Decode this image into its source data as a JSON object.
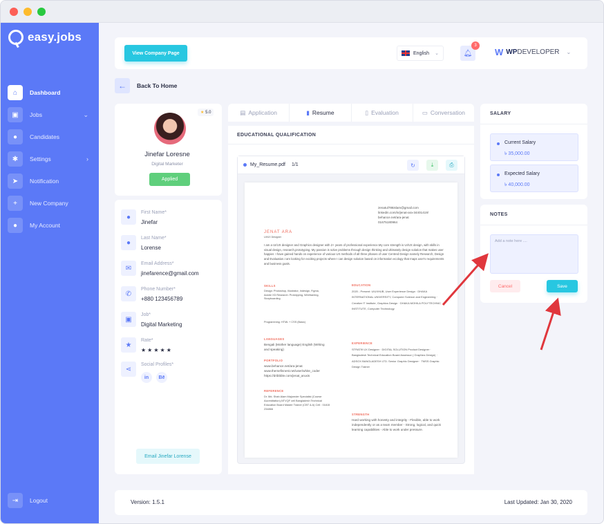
{
  "app": {
    "name": "easy.jobs"
  },
  "colors": {
    "primary": "#5b79f7",
    "accent": "#27c7e1",
    "success": "#5fcf7c",
    "danger": "#ff6b6b",
    "star": "#fdbb2d"
  },
  "sidebar": {
    "items": [
      {
        "label": "Dashboard",
        "icon": "home-icon"
      },
      {
        "label": "Jobs",
        "icon": "briefcase-icon"
      },
      {
        "label": "Candidates",
        "icon": "user-icon"
      },
      {
        "label": "Settings",
        "icon": "gear-icon"
      },
      {
        "label": "Notification",
        "icon": "pointer-icon"
      },
      {
        "label": "New Company",
        "icon": "plus-icon"
      },
      {
        "label": "My Account",
        "icon": "user-icon"
      }
    ],
    "logout": "Logout"
  },
  "topbar": {
    "view_company": "View Company Page",
    "language": "English",
    "notifications": "3",
    "brand_wp": "WP",
    "brand_rest": "DEVELOPER"
  },
  "back": {
    "label": "Back To Home"
  },
  "candidate": {
    "rating": "5.0",
    "name": "Jinefar Loresne",
    "title": "Digital Marketer",
    "status": "Applied",
    "fields": {
      "first_name": {
        "label": "First Name*",
        "value": "Jinefar"
      },
      "last_name": {
        "label": "Last Name*",
        "value": "Lorense"
      },
      "email": {
        "label": "Email Address*",
        "value": "jinefarence@gmail.com"
      },
      "phone": {
        "label": "Phone Number*",
        "value": "+880 123456789"
      },
      "job": {
        "label": "Job*",
        "value": "Digital Marketing"
      },
      "rate": {
        "label": "Rate*",
        "value": "★★★★★"
      },
      "social": {
        "label": "Social Profiles*",
        "linkedin": "in",
        "behance": "Bē"
      }
    },
    "email_button": "Email Jinefar Lorense"
  },
  "tabs": [
    {
      "label": "Application"
    },
    {
      "label": "Resume"
    },
    {
      "label": "Evaluation"
    },
    {
      "label": "Conversation"
    }
  ],
  "resume": {
    "section_title": "EDUCATIONAL QUALIFICATION",
    "file_name": "My_Resume.pdf",
    "page": "1/1",
    "doc": {
      "contact1": "zenatul786islam@gmail.com",
      "contact2": "linkedin.com/in/jenat-ara-34401419/",
      "contact3": "behance.net/ara-jenat",
      "contact4": "01675180964",
      "name": "JENAT ARA",
      "role": "UI/UX Designer",
      "summary": "I am a UI/UX designer and Graphics designer with 2+ years of professional experience.My core strength is UI/UX design, with skills in visual design, research,prototyping. My passion is solve problems through design thinking and ultimately design solution that makes user happier. I have gained hands on experience of various UX methods of all three phases of user Centred Design namely Research, Design and Evaluation.I am looking for exciting projects where I can design solution based on information ecology that maps user's requirements and business goals.",
      "skills_h": "SKILLS",
      "skills": "Design: Photoshop, Illustrator, Indesign, Figma, Adobe XD  Research: Prototyping, Wireframing, Storyboarding",
      "programming": "Programming: HTML + CSS (Basic)",
      "languages_h": "LANGUAGES",
      "languages": "Bengali (Mother language) English (Writing and speaking)",
      "portfolio_h": "PORTFOLIO",
      "portfolio": "www.behance.net/ara-jenat www.themefisnest.net/user/white_coder https://dribbble.com/jenat_aruxis",
      "reference_h": "REFERENCE",
      "reference": "Dr. Md. Shah Alam Majumder Specialist (Course Accreditation),NTVQF cell Bangladesh Technical Education Board Master Trainer (CBT & A) Cell : 01815 234866",
      "education_h": "EDUCATION",
      "education": "2020 - Present: UIUXHUB, User Experience Design · DHAKA INTERNATIONAL UNIVERSITY, Computer Science and Engineering · Creative IT Institute, Graphics Design · DHAKA MOHILA POLYTECHNIC INSTITUTE, Computer Technology",
      "experience_h": "EXPERIENCE",
      "experience": "STRATI9 UX Designer · DIGITAL SOLUTION Product Designer · Bangladesh Technical Education Board Assessor ( Graphics Design) · ADSOX BANGLADESH LTD. Senior Graphic Designer · TMSS Graphic Design Trainer",
      "strength_h": "STRENGTH",
      "strength": "Hard working with honesty and integrity - Flexible, able to work independently or as a team member - Strong, logical, and quick learning capabilities - Able to work under pressure."
    }
  },
  "salary": {
    "title": "SALARY",
    "current_label": "Current Salary",
    "current_value": "৳ 35,000.00",
    "expected_label": "Expected Salary",
    "expected_value": "৳ 40,000.00"
  },
  "notes": {
    "title": "NOTES",
    "placeholder": "Add a note here ....",
    "cancel": "Cancel",
    "save": "Save"
  },
  "footer": {
    "version": "Version: 1.5.1",
    "updated": "Last Updated: Jan 30, 2020"
  }
}
